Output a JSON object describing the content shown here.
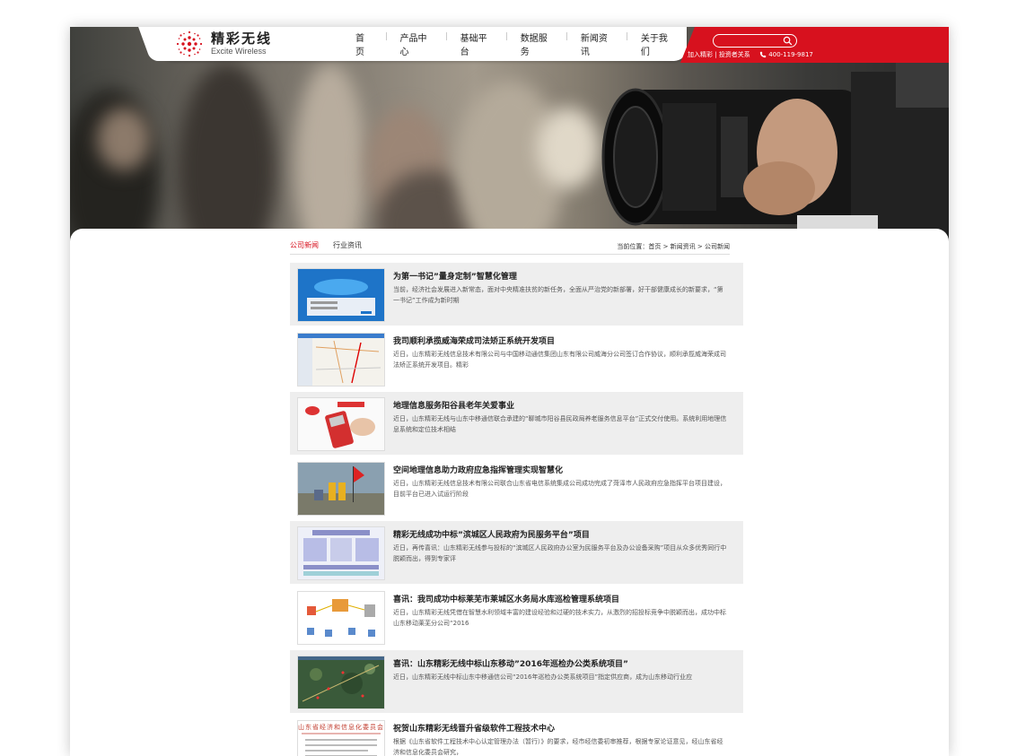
{
  "brand": {
    "name_cn": "精彩无线",
    "name_en": "Excite Wireless",
    "color": "#d7111e"
  },
  "nav": [
    "首页",
    "产品中心",
    "基础平台",
    "数据服务",
    "新闻资讯",
    "关于我们"
  ],
  "header_links": {
    "join": "加入精彩",
    "separator": " | ",
    "investor": "投资者关系",
    "phone": "400-119-9817"
  },
  "search": {
    "placeholder": ""
  },
  "tabs": [
    "公司新闻",
    "行业资讯"
  ],
  "breadcrumb": {
    "prefix": "当前位置：",
    "home": "首页",
    "sep1": " > ",
    "news": "新闻资讯",
    "sep2": " > ",
    "current": "公司新闻"
  },
  "news": [
    {
      "title": "为第一书记”量身定制”智慧化管理",
      "desc": "当前，经济社会发展进入新常态，面对中央精准扶贫的新任务，全面从严治党的新部署，好干部健康成长的新要求，“第一书记”工作成为新时期"
    },
    {
      "title": "我司顺利承揽威海荣成司法矫正系统开发项目",
      "desc": "近日，山东精彩无线信息技术有限公司与中国移动通信集团山东有限公司威海分公司签订合作协议，顺利承揽威海荣成司法矫正系统开发项目。精彩"
    },
    {
      "title": "地理信息服务阳谷县老年关爱事业",
      "desc": "近日，山东精彩无线与山东中移通信联合承建的“聊城市阳谷县民政局养老服务信息平台”正式交付使用。系统利用地理信息系统和定位技术相结"
    },
    {
      "title": "空间地理信息助力政府应急指挥管理实现智慧化",
      "desc": "近日，山东精彩无线信息技术有限公司联合山东省电信系统集成公司成功完成了菏泽市人民政府应急指挥平台项目建设，目前平台已进入试运行阶段"
    },
    {
      "title": "精彩无线成功中标”滨城区人民政府为民服务平台”项目",
      "desc": "近日，再传喜讯：山东精彩无线参与投标的“滨城区人民政府办公室为民服务平台及办公设备采购”项目从众多优秀同行中脱颖而出，得到专家评"
    },
    {
      "title": "喜讯：我司成功中标莱芜市莱城区水务局水库巡检管理系统项目",
      "desc": "近日，山东精彩无线凭借在智慧水利领域丰富的建设经验和过硬的技术实力，从激烈的招投标竞争中脱颖而出，成功中标山东移动莱芜分公司“2016"
    },
    {
      "title": "喜讯：山东精彩无线中标山东移动”2016年巡检办公类系统项目”",
      "desc": "近日，山东精彩无线中标山东中移通信公司“2016年巡检办公类系统项目”指定供应商，成为山东移动行业应"
    },
    {
      "title": "祝贺山东精彩无线晋升省级软件工程技术中心",
      "desc": "根据《山东省软件工程技术中心认定管理办法（暂行）》的要求，经市经信委初审推荐，根据专家论证意见，经山东省经济和信息化委员会研究，"
    }
  ],
  "thumbs": {
    "thumb8_heading": "山东省经济和信息化委员会"
  }
}
